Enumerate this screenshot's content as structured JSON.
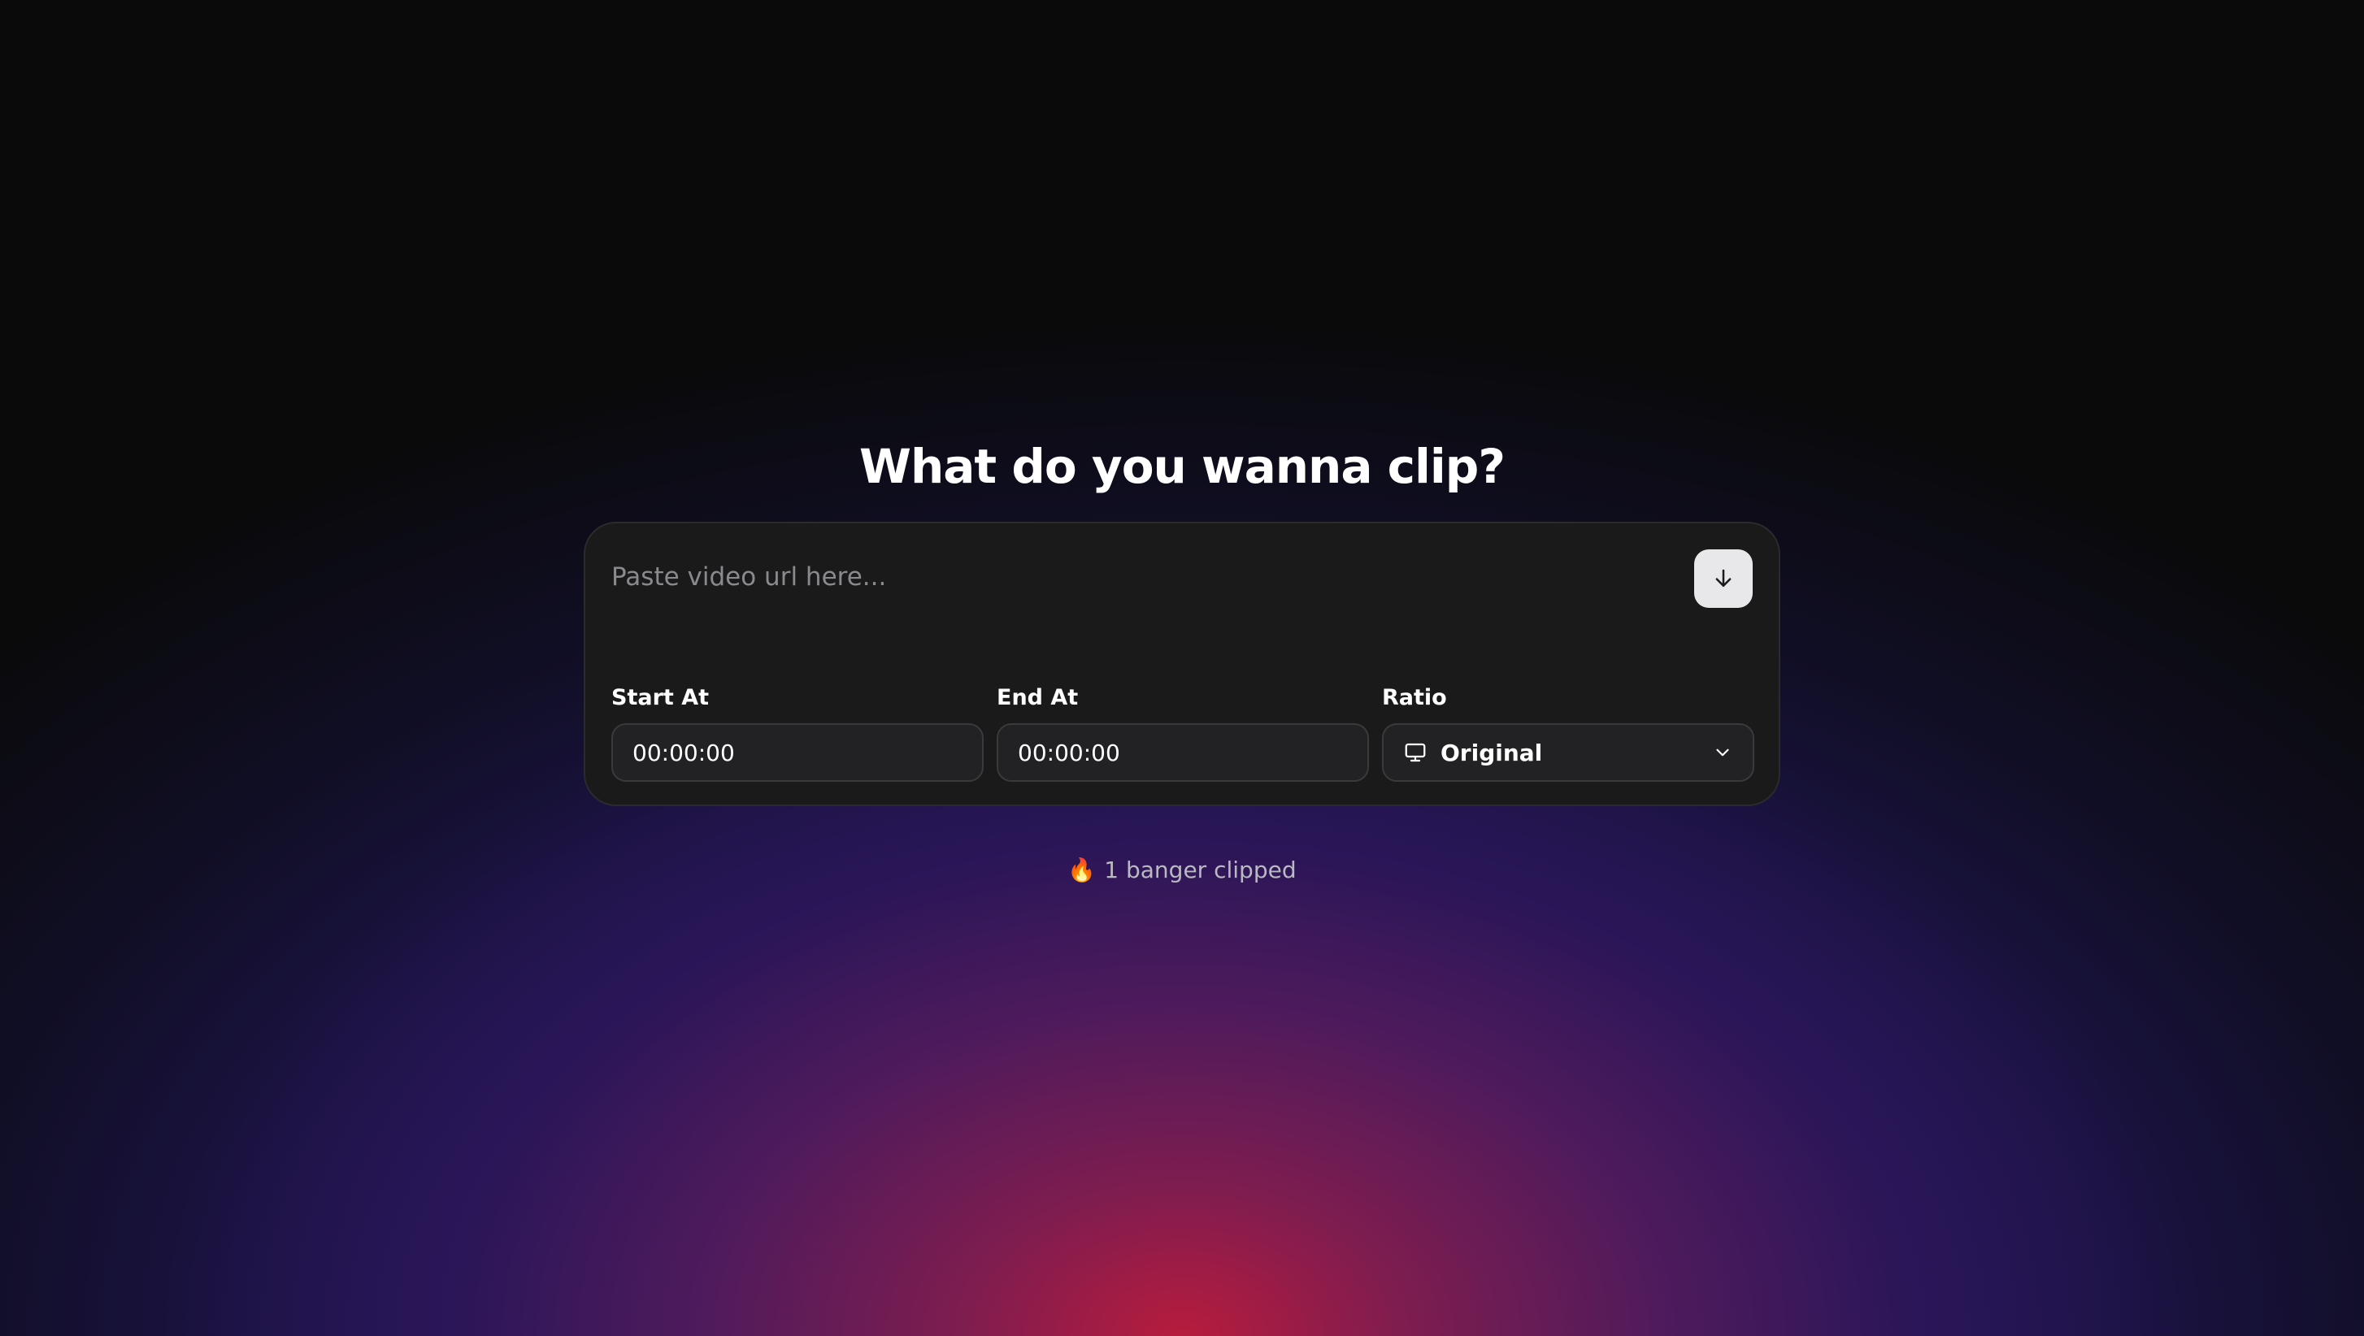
{
  "page": {
    "title": "What do you wanna clip?"
  },
  "url_input": {
    "placeholder": "Paste video url here...",
    "value": ""
  },
  "download_button": {
    "icon": "arrow-down-icon"
  },
  "fields": {
    "start": {
      "label": "Start At",
      "value": "00:00:00"
    },
    "end": {
      "label": "End At",
      "value": "00:00:00"
    },
    "ratio": {
      "label": "Ratio",
      "value": "Original",
      "icon": "monitor-icon",
      "chevron": "chevron-down-icon"
    }
  },
  "footer": {
    "emoji": "🔥",
    "text": "1 banger clipped"
  },
  "colors": {
    "background": "#0a0a0b",
    "card": "#1a1a1b",
    "button": "#e8e8ea",
    "glow_red": "#be1c3a",
    "glow_purple": "#381a6e"
  }
}
